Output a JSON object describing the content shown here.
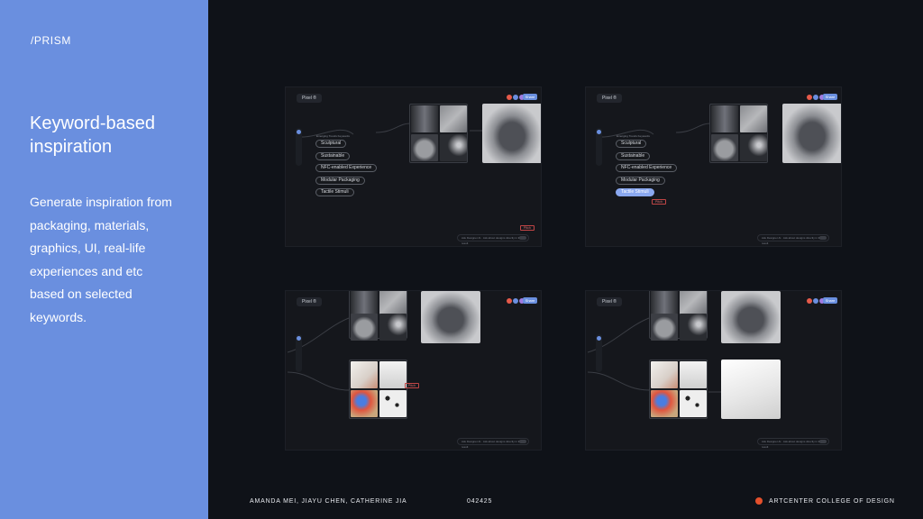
{
  "sidebar": {
    "brand": "/PRISM",
    "title": "Keyword-based inspiration",
    "description": "Generate inspiration from packaging, materials, graphics, UI,  real-life experiences and etc based on selected keywords."
  },
  "footer": {
    "authors": "AMANDA MEI, JIAYU CHEN, CATHERINE JIA",
    "date": "042425",
    "school": "ARTCENTER COLLEGE OF DESIGN"
  },
  "app": {
    "project_label": "Pixel ®",
    "share_label": "Share",
    "keywords_header": "Emerging Trends Keywords",
    "keywords": [
      "Sculptural",
      "Sustainable",
      "NFC-enabled Experience",
      "Modular Packaging",
      "Tactile Stimuli"
    ],
    "cursor_tag": "Pitch",
    "chat_placeholder": "Ask Designer AI · Ask about designs directly in the result",
    "colors": {
      "panel": "#6a8fdf",
      "selected_pill": "#8aa8ef",
      "brand_dot": "#e4502c"
    }
  }
}
